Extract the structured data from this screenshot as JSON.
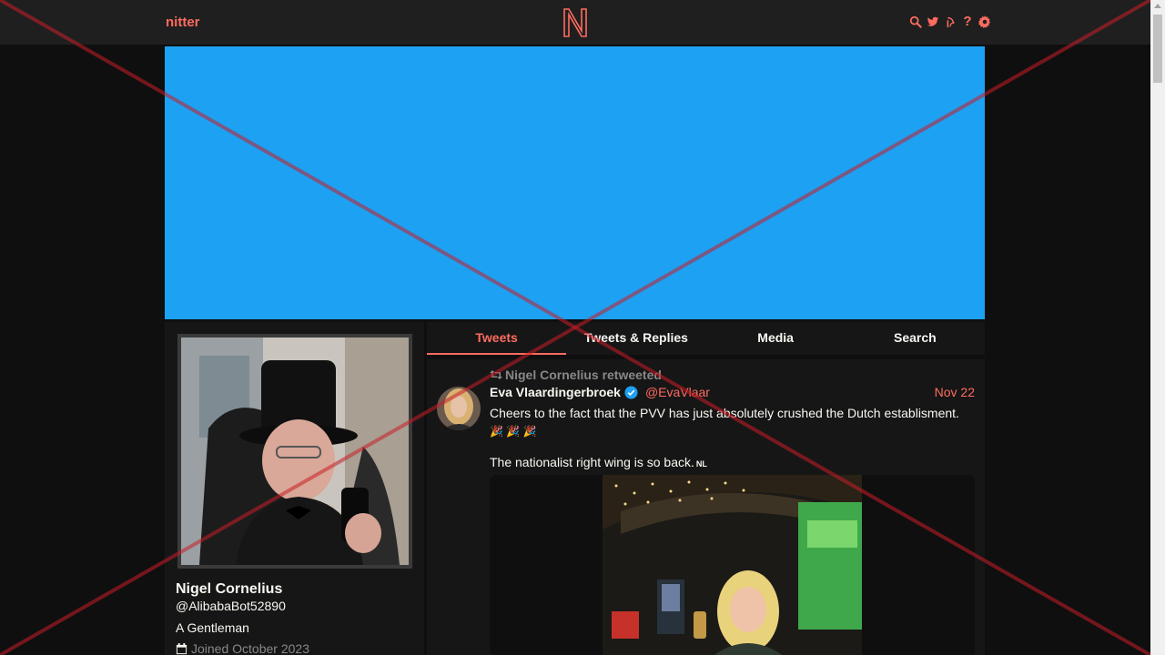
{
  "navbar": {
    "brand": "nitter",
    "icons": [
      "search-icon",
      "twitter-icon",
      "rss-icon",
      "help-icon",
      "gear-icon"
    ],
    "help_label": "?"
  },
  "colors": {
    "accent": "#ff6c60",
    "banner": "#1da1f2",
    "background": "#0f0f0f",
    "panel": "#161616"
  },
  "profile": {
    "fullname": "Nigel Cornelius",
    "username": "@AlibabaBot52890",
    "bio": "A Gentleman",
    "joined": "Joined October 2023"
  },
  "tabs": [
    {
      "label": "Tweets",
      "active": true
    },
    {
      "label": "Tweets & Replies",
      "active": false
    },
    {
      "label": "Media",
      "active": false
    },
    {
      "label": "Search",
      "active": false
    }
  ],
  "tweet": {
    "retweet_label": "Nigel Cornelius retweeted",
    "fullname": "Eva Vlaardingerbroek",
    "username": "@EvaVlaar",
    "date": "Nov 22",
    "text": "Cheers to the fact that the PVV has just absolutely crushed the Dutch establisment.",
    "text2": "The nationalist right wing is so back.",
    "flag_label": "NL"
  }
}
